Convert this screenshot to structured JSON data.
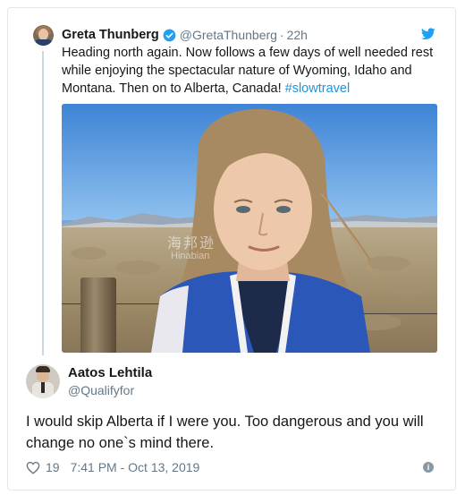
{
  "quoted_tweet": {
    "author_name": "Greta Thunberg",
    "author_handle": "@GretaThunberg",
    "separator": "·",
    "time_ago": "22h",
    "text_before_hashtag": "Heading north again. Now follows a few days of well needed rest while enjoying the spectacular nature of Wyoming, Idaho and Montana. Then on to Alberta, Canada! ",
    "hashtag": "#slowtravel",
    "verified": true,
    "photo_watermark": "海邦逊",
    "photo_watermark_sub": "Hinabian"
  },
  "reply_tweet": {
    "author_name": "Aatos Lehtila",
    "author_handle": "@Qualifyfor",
    "text": "I would skip Alberta if I were you.  Too dangerous and you will change no one`s mind there.",
    "like_count": "19",
    "timestamp": "7:41 PM - Oct 13, 2019"
  },
  "icons": {
    "brand": "twitter-bird-icon",
    "verified": "verified-badge-icon",
    "like": "heart-icon",
    "info": "info-icon"
  },
  "colors": {
    "brand_blue": "#1da1f2",
    "hashtag_blue": "#1b95e0",
    "secondary_text": "#657786",
    "thread_line": "#ccd6dd"
  }
}
